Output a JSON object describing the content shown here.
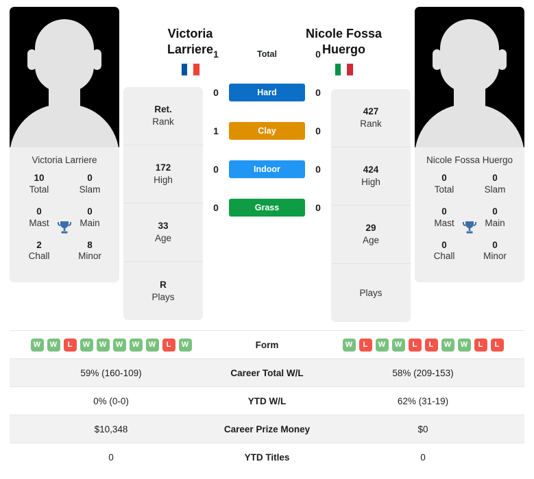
{
  "players": {
    "left": {
      "name": "Victoria Larriere",
      "name_line1": "Victoria",
      "name_line2": "Larriere",
      "card_name": "Victoria Larriere",
      "country": "France",
      "flag_colors": [
        "#0055A4",
        "#FFFFFF",
        "#EF4135"
      ],
      "titles": [
        {
          "value": "10",
          "label": "Total"
        },
        {
          "value": "0",
          "label": "Slam"
        },
        {
          "value": "0",
          "label": "Mast"
        },
        {
          "value": "0",
          "label": "Main"
        },
        {
          "value": "2",
          "label": "Chall"
        },
        {
          "value": "8",
          "label": "Minor"
        }
      ],
      "rank_card": [
        {
          "value": "Ret.",
          "label": "Rank"
        },
        {
          "value": "172",
          "label": "High"
        },
        {
          "value": "33",
          "label": "Age"
        },
        {
          "value": "R",
          "label": "Plays"
        }
      ],
      "form": [
        "W",
        "W",
        "L",
        "W",
        "W",
        "W",
        "W",
        "W",
        "L",
        "W"
      ]
    },
    "right": {
      "name": "Nicole Fossa Huergo",
      "name_line1": "Nicole Fossa",
      "name_line2": "Huergo",
      "card_name": "Nicole Fossa Huergo",
      "country": "Italy",
      "flag_colors": [
        "#009246",
        "#FFFFFF",
        "#CE2B37"
      ],
      "titles": [
        {
          "value": "0",
          "label": "Total"
        },
        {
          "value": "0",
          "label": "Slam"
        },
        {
          "value": "0",
          "label": "Mast"
        },
        {
          "value": "0",
          "label": "Main"
        },
        {
          "value": "0",
          "label": "Chall"
        },
        {
          "value": "0",
          "label": "Minor"
        }
      ],
      "rank_card": [
        {
          "value": "427",
          "label": "Rank"
        },
        {
          "value": "424",
          "label": "High"
        },
        {
          "value": "29",
          "label": "Age"
        },
        {
          "value": "",
          "label": "Plays"
        }
      ],
      "form": [
        "W",
        "L",
        "W",
        "W",
        "L",
        "L",
        "W",
        "W",
        "L",
        "L"
      ]
    }
  },
  "head_to_head": [
    {
      "label": "Total",
      "left": "1",
      "right": "0",
      "badge": false,
      "color": ""
    },
    {
      "label": "Hard",
      "left": "0",
      "right": "0",
      "badge": true,
      "color": "#0d6ec5"
    },
    {
      "label": "Clay",
      "left": "1",
      "right": "0",
      "badge": true,
      "color": "#df9000"
    },
    {
      "label": "Indoor",
      "left": "0",
      "right": "0",
      "badge": true,
      "color": "#2196f3"
    },
    {
      "label": "Grass",
      "left": "0",
      "right": "0",
      "badge": true,
      "color": "#0e9c44"
    }
  ],
  "stats_rows": [
    {
      "label": "Form",
      "left": "",
      "right": "",
      "type": "form"
    },
    {
      "label": "Career Total W/L",
      "left": "59% (160-109)",
      "right": "58% (209-153)",
      "type": "text"
    },
    {
      "label": "YTD W/L",
      "left": "0% (0-0)",
      "right": "62% (31-19)",
      "type": "text"
    },
    {
      "label": "Career Prize Money",
      "left": "$10,348",
      "right": "$0",
      "type": "text"
    },
    {
      "label": "YTD Titles",
      "left": "0",
      "right": "0",
      "type": "text"
    }
  ],
  "colors": {
    "form_win": "#7ac17f",
    "form_loss": "#f4554a",
    "trophy": "#3d6fa8",
    "card_bg": "#efefef",
    "row_alt": "#f2f2f2"
  }
}
